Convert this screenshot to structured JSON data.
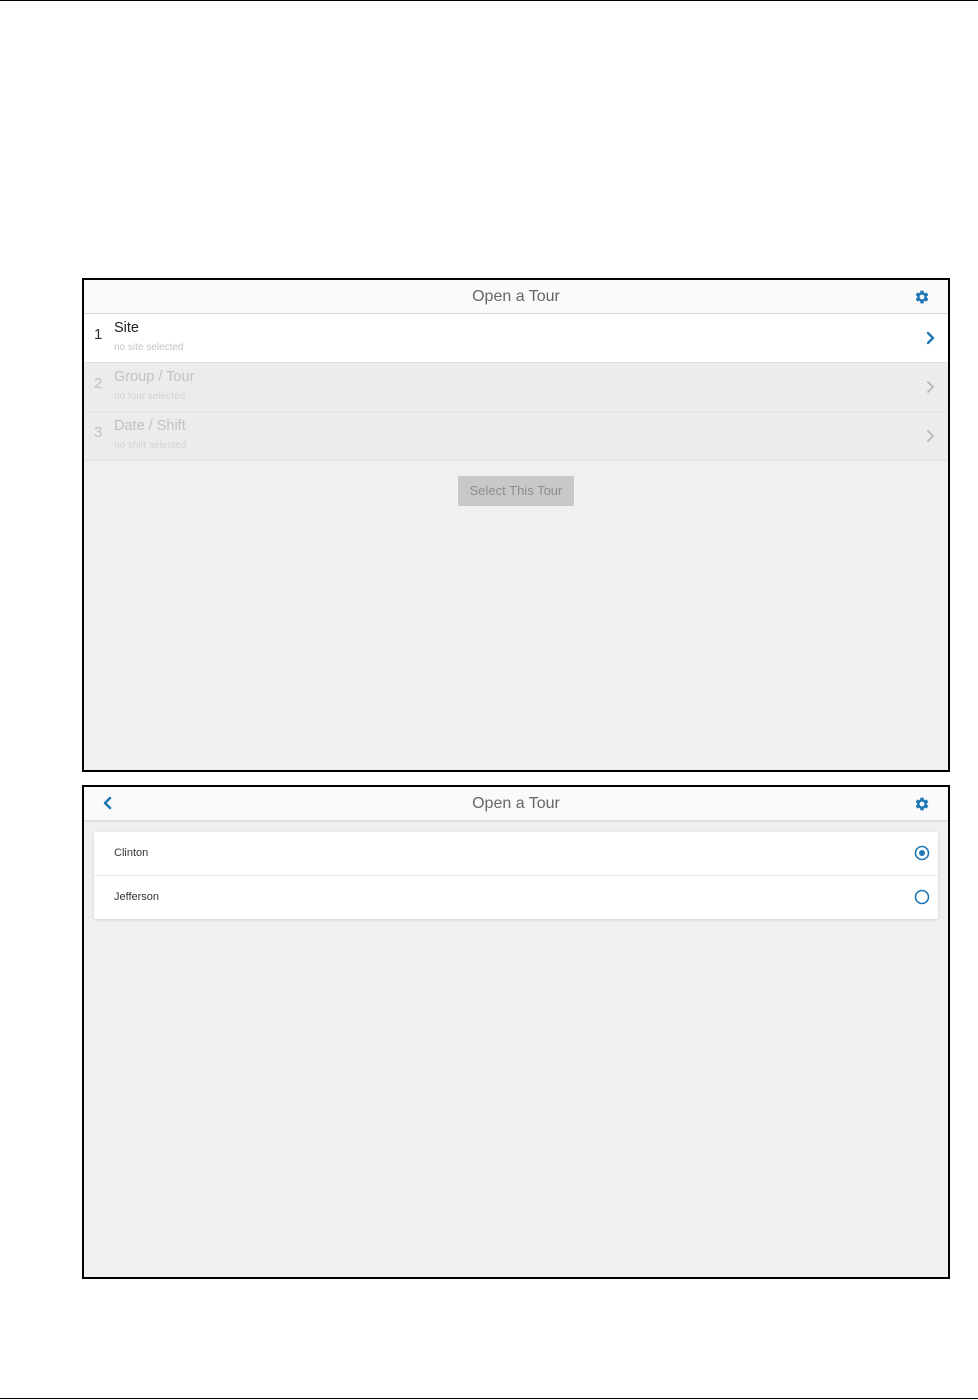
{
  "colors": {
    "accent": "#1f77b4",
    "screen_background": "#f0f0f0",
    "disabled_button": "#c8c8c8"
  },
  "screen1": {
    "header": {
      "title": "Open a Tour",
      "settings_icon": "gear-icon"
    },
    "steps": [
      {
        "number": "1",
        "label": "Site",
        "sublabel": "no site selected",
        "state": "active",
        "icon": "chevron-right-icon"
      },
      {
        "number": "2",
        "label": "Group / Tour",
        "sublabel": "no tour selected",
        "state": "disabled",
        "icon": "chevron-right-icon"
      },
      {
        "number": "3",
        "label": "Date / Shift",
        "sublabel": "no shift selected",
        "state": "disabled",
        "icon": "chevron-right-icon"
      }
    ],
    "select_button": {
      "label": "Select This Tour",
      "enabled": false
    }
  },
  "screen2": {
    "header": {
      "title": "Open a Tour",
      "back_icon": "chevron-left-icon",
      "settings_icon": "gear-icon"
    },
    "sites": [
      {
        "name": "Clinton",
        "selected": true
      },
      {
        "name": "Jefferson",
        "selected": false
      }
    ]
  }
}
